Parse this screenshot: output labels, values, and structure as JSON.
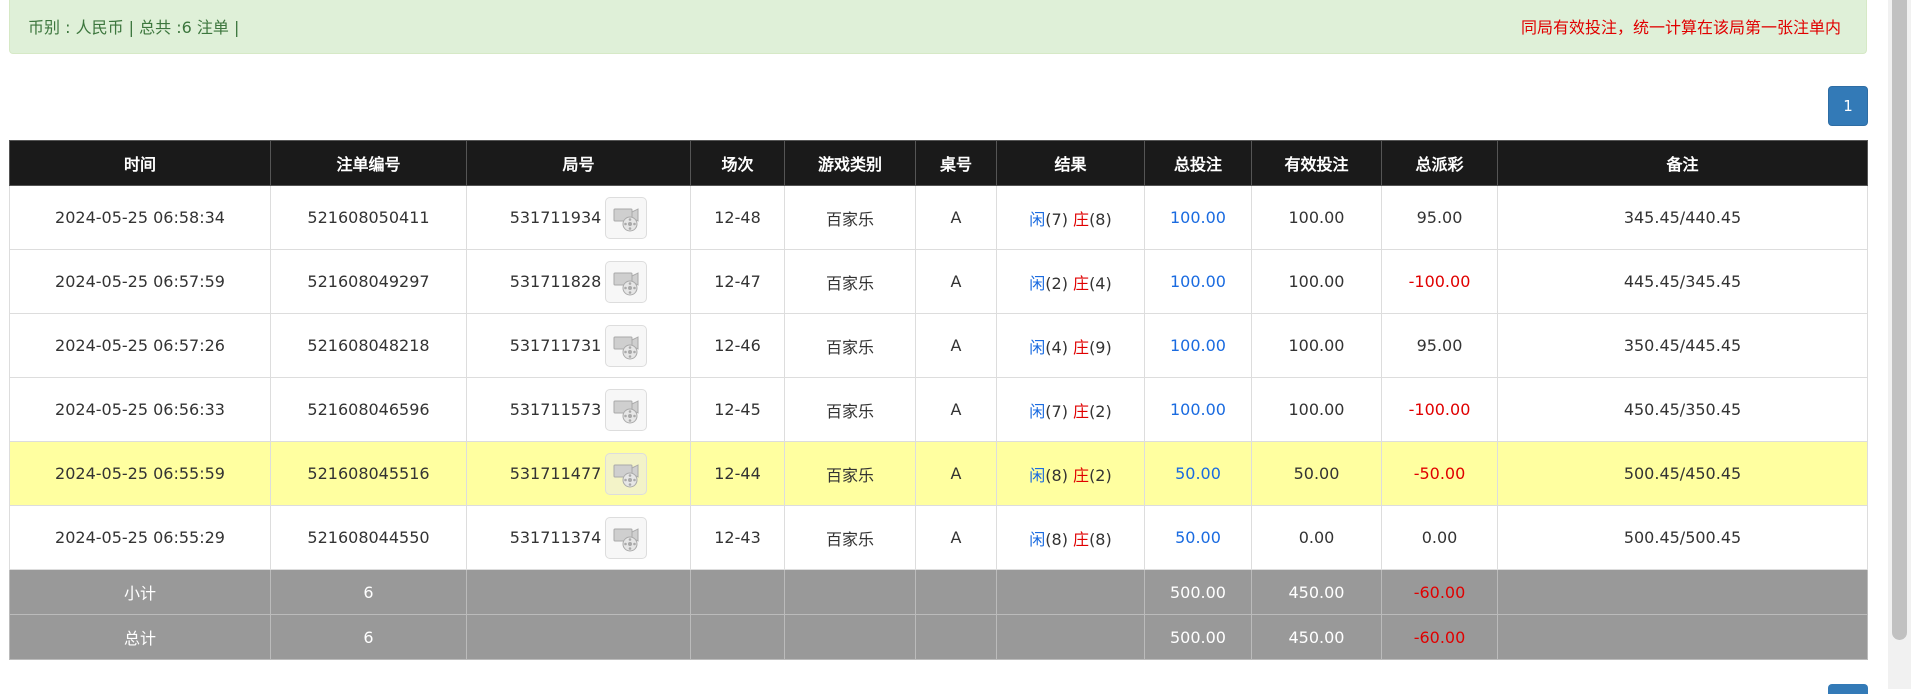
{
  "info": {
    "summary": "币别 : 人民币 | 总共 :6 注单 |",
    "notice": "同局有效投注，统一计算在该局第一张注单内"
  },
  "pager": {
    "current": "1"
  },
  "table": {
    "headers": [
      "时间",
      "注单编号",
      "局号",
      "场次",
      "游戏类别",
      "桌号",
      "结果",
      "总投注",
      "有效投注",
      "总派彩",
      "备注"
    ],
    "rows": [
      {
        "time": "2024-05-25 06:58:34",
        "bet_id": "521608050411",
        "round": "531711934",
        "shoe": "12-48",
        "game": "百家乐",
        "table": "A",
        "player_label": "闲",
        "player_val": "(7)",
        "banker_label": "庄",
        "banker_val": "(8)",
        "total_bet": "100.00",
        "valid_bet": "100.00",
        "payout": "95.00",
        "payout_negative": false,
        "note": "345.45/440.45",
        "highlight": false
      },
      {
        "time": "2024-05-25 06:57:59",
        "bet_id": "521608049297",
        "round": "531711828",
        "shoe": "12-47",
        "game": "百家乐",
        "table": "A",
        "player_label": "闲",
        "player_val": "(2)",
        "banker_label": "庄",
        "banker_val": "(4)",
        "total_bet": "100.00",
        "valid_bet": "100.00",
        "payout": "-100.00",
        "payout_negative": true,
        "note": "445.45/345.45",
        "highlight": false
      },
      {
        "time": "2024-05-25 06:57:26",
        "bet_id": "521608048218",
        "round": "531711731",
        "shoe": "12-46",
        "game": "百家乐",
        "table": "A",
        "player_label": "闲",
        "player_val": "(4)",
        "banker_label": "庄",
        "banker_val": "(9)",
        "total_bet": "100.00",
        "valid_bet": "100.00",
        "payout": "95.00",
        "payout_negative": false,
        "note": "350.45/445.45",
        "highlight": false
      },
      {
        "time": "2024-05-25 06:56:33",
        "bet_id": "521608046596",
        "round": "531711573",
        "shoe": "12-45",
        "game": "百家乐",
        "table": "A",
        "player_label": "闲",
        "player_val": "(7)",
        "banker_label": "庄",
        "banker_val": "(2)",
        "total_bet": "100.00",
        "valid_bet": "100.00",
        "payout": "-100.00",
        "payout_negative": true,
        "note": "450.45/350.45",
        "highlight": false
      },
      {
        "time": "2024-05-25 06:55:59",
        "bet_id": "521608045516",
        "round": "531711477",
        "shoe": "12-44",
        "game": "百家乐",
        "table": "A",
        "player_label": "闲",
        "player_val": "(8)",
        "banker_label": "庄",
        "banker_val": "(2)",
        "total_bet": "50.00",
        "valid_bet": "50.00",
        "payout": "-50.00",
        "payout_negative": true,
        "note": "500.45/450.45",
        "highlight": true
      },
      {
        "time": "2024-05-25 06:55:29",
        "bet_id": "521608044550",
        "round": "531711374",
        "shoe": "12-43",
        "game": "百家乐",
        "table": "A",
        "player_label": "闲",
        "player_val": "(8)",
        "banker_label": "庄",
        "banker_val": "(8)",
        "total_bet": "50.00",
        "valid_bet": "0.00",
        "payout": "0.00",
        "payout_negative": false,
        "note": "500.45/500.45",
        "highlight": false
      }
    ],
    "subtotal": {
      "label": "小计",
      "count": "6",
      "total_bet": "500.00",
      "valid_bet": "450.00",
      "payout": "-60.00"
    },
    "grandtotal": {
      "label": "总计",
      "count": "6",
      "total_bet": "500.00",
      "valid_bet": "450.00",
      "payout": "-60.00"
    }
  },
  "icons": {
    "replay": "video-replay-icon"
  },
  "colors": {
    "blue_amount": "#1a6be0",
    "red_amount": "#e00000",
    "header_bg": "#1a1a1a",
    "highlight_row": "#ffffa0",
    "summary_row": "#999999",
    "info_bg": "#dff0d8"
  }
}
